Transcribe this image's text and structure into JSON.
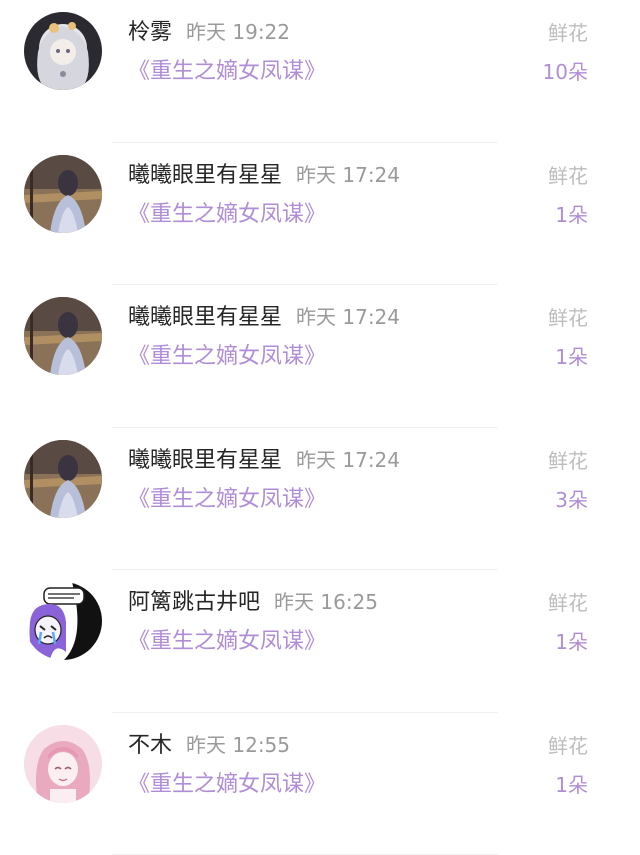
{
  "records": [
    {
      "user": "柃雾",
      "time": "昨天 19:22",
      "book": "《重生之嫡女凤谋》",
      "gift_label": "鲜花",
      "count": "10朵",
      "avatar_icon": "anime-girl-white-hair-avatar"
    },
    {
      "user": "曦曦眼里有星星",
      "time": "昨天 17:24",
      "book": "《重生之嫡女凤谋》",
      "gift_label": "鲜花",
      "count": "1朵",
      "avatar_icon": "girl-at-sunset-avatar"
    },
    {
      "user": "曦曦眼里有星星",
      "time": "昨天 17:24",
      "book": "《重生之嫡女凤谋》",
      "gift_label": "鲜花",
      "count": "1朵",
      "avatar_icon": "girl-at-sunset-avatar"
    },
    {
      "user": "曦曦眼里有星星",
      "time": "昨天 17:24",
      "book": "《重生之嫡女凤谋》",
      "gift_label": "鲜花",
      "count": "3朵",
      "avatar_icon": "girl-at-sunset-avatar"
    },
    {
      "user": "阿篱跳古井吧",
      "time": "昨天 16:25",
      "book": "《重生之嫡女凤谋》",
      "gift_label": "鲜花",
      "count": "1朵",
      "avatar_icon": "crying-manga-girl-avatar"
    },
    {
      "user": "不木",
      "time": "昨天 12:55",
      "book": "《重生之嫡女凤谋》",
      "gift_label": "鲜花",
      "count": "1朵",
      "avatar_icon": "pink-anime-girl-avatar"
    }
  ],
  "colors": {
    "accent": "#b08ed6",
    "username": "#262626",
    "muted": "#9a9a9a",
    "gift_label": "#bdbdbd"
  }
}
